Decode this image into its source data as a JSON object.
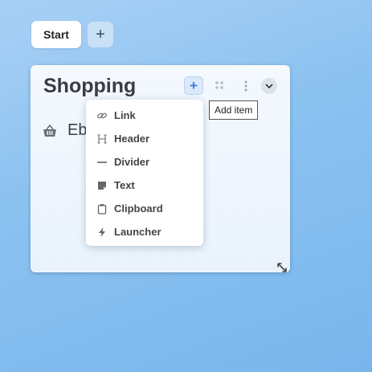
{
  "tabs": [
    {
      "label": "Start"
    }
  ],
  "add_tab_label": "+",
  "panel": {
    "title": "Shopping",
    "add_button_label": "+",
    "items": [
      {
        "label": "Eb",
        "icon": "basket-icon"
      }
    ]
  },
  "tooltip": {
    "text": "Add item"
  },
  "menu": {
    "items": [
      {
        "label": "Link",
        "icon": "link-icon"
      },
      {
        "label": "Header",
        "icon": "header-icon"
      },
      {
        "label": "Divider",
        "icon": "divider-icon"
      },
      {
        "label": "Text",
        "icon": "note-icon"
      },
      {
        "label": "Clipboard",
        "icon": "clipboard-icon"
      },
      {
        "label": "Launcher",
        "icon": "bolt-icon"
      }
    ]
  },
  "colors": {
    "accent": "#3b7de0",
    "text": "#3a3d42",
    "background": "#8cc2f0"
  }
}
